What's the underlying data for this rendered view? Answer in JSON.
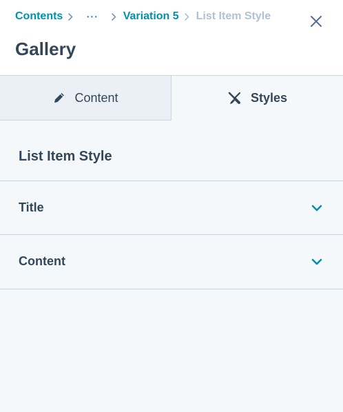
{
  "breadcrumb": {
    "root": "Contents",
    "ellipsis": "•••",
    "variation": "Variation 5",
    "current": "List Item Style"
  },
  "header": {
    "title": "Gallery"
  },
  "tabs": [
    {
      "label": "Content",
      "icon": "pencil-icon",
      "selected": false
    },
    {
      "label": "Styles",
      "icon": "brush-icon",
      "selected": true
    }
  ],
  "section": {
    "heading": "List Item Style"
  },
  "accordion": [
    {
      "label": "Title",
      "expanded": false
    },
    {
      "label": "Content",
      "expanded": false
    }
  ],
  "colors": {
    "link": "#0091ae",
    "text": "#33475b",
    "muted": "#b0c1d4",
    "border": "#cbd6e2",
    "background": "#f5f8fa"
  }
}
